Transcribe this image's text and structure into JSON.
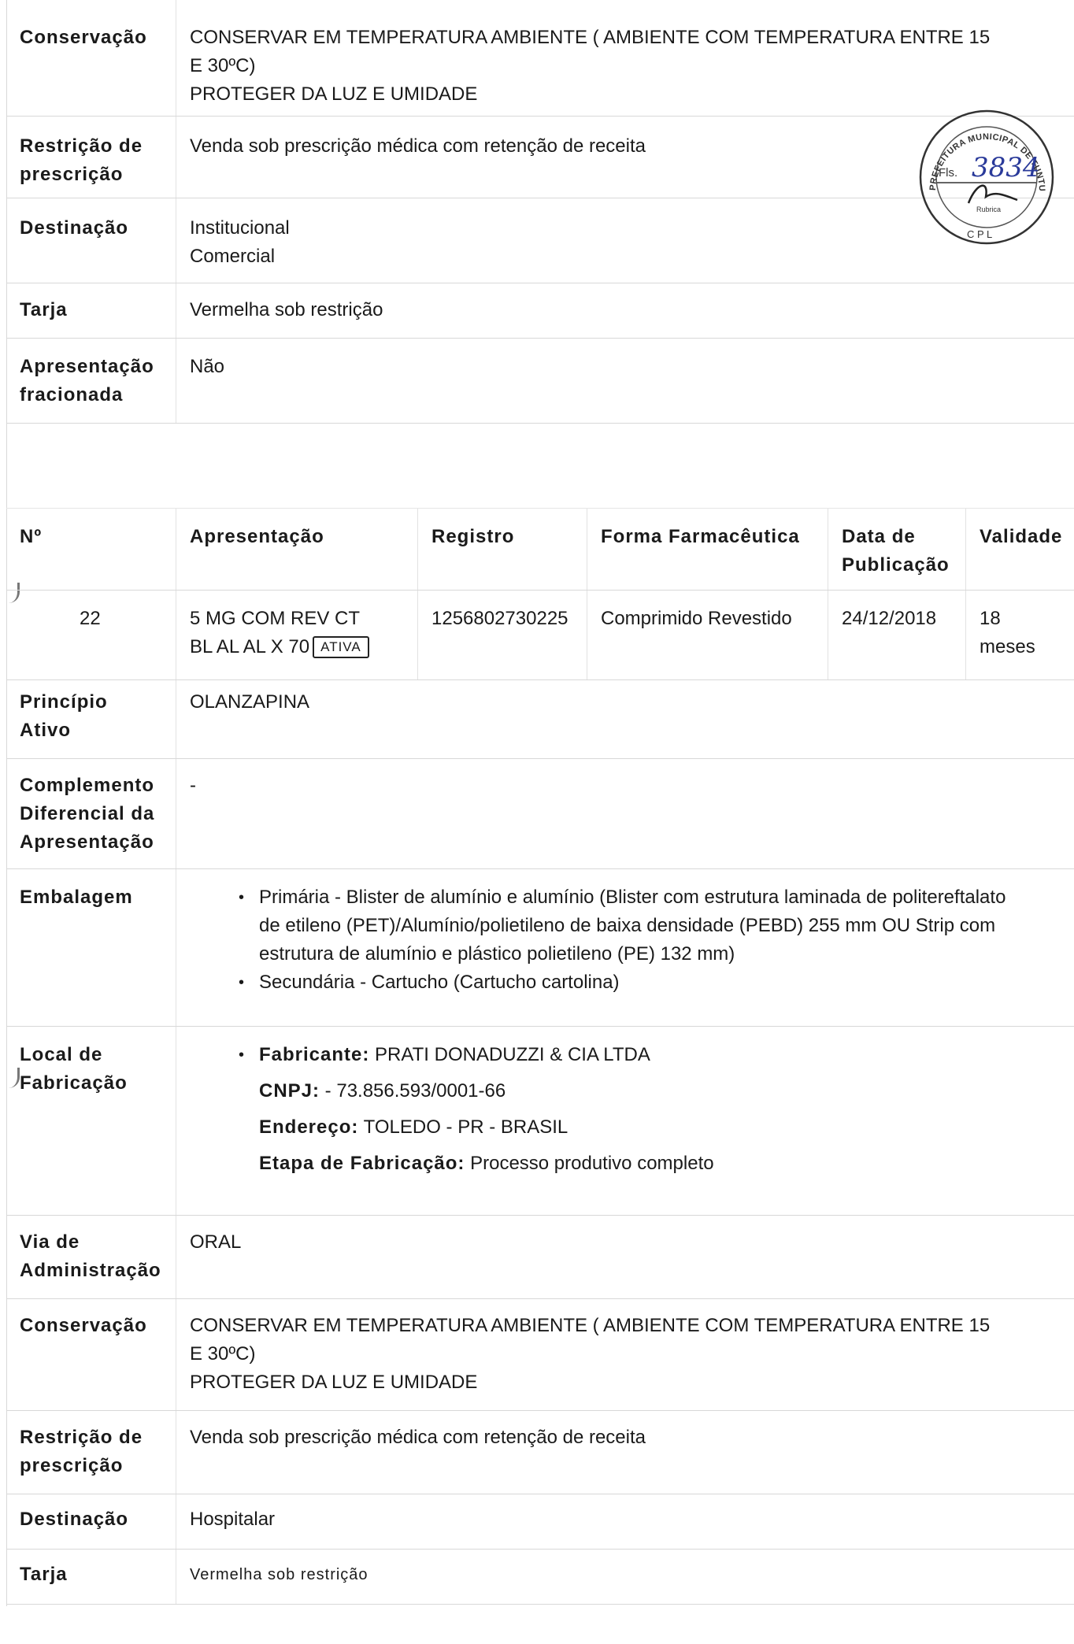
{
  "block1": {
    "conservacao": {
      "label": "Conservação",
      "lines": [
        "CONSERVAR EM TEMPERATURA AMBIENTE ( AMBIENTE COM TEMPERATURA ENTRE 15",
        "E 30ºC)",
        "PROTEGER DA LUZ E UMIDADE"
      ]
    },
    "restricao": {
      "label_line1": "Restrição de",
      "label_line2": "prescrição",
      "value": "Venda sob prescrição médica com retenção de receita"
    },
    "destinacao": {
      "label": "Destinação",
      "lines": [
        "Institucional",
        "Comercial"
      ]
    },
    "tarja": {
      "label": "Tarja",
      "value": "Vermelha sob restrição"
    },
    "fracionada": {
      "label_line1": "Apresentação",
      "label_line2": "fracionada",
      "value": "Não"
    }
  },
  "seal": {
    "ring_text": "PREFEITURA MUNICIPAL DE TUNTUM-MA",
    "fls_label": "Fls.",
    "number": "3834",
    "rubrica": "Rubrica",
    "cpl": "C P L"
  },
  "table_header": {
    "n": "Nº",
    "apresentacao": "Apresentação",
    "registro": "Registro",
    "forma": "Forma Farmacêutica",
    "data_line1": "Data de",
    "data_line2": "Publicação",
    "validade": "Validade"
  },
  "row22": {
    "n": "22",
    "apres_line1": "5 MG COM REV CT",
    "apres_line2": "BL AL AL X 70",
    "badge": "ATIVA",
    "registro": "1256802730225",
    "forma": "Comprimido Revestido",
    "data": "24/12/2018",
    "validade_line1": "18",
    "validade_line2": "meses"
  },
  "block2": {
    "principio": {
      "label_line1": "Princípio",
      "label_line2": "Ativo",
      "value": "OLANZAPINA"
    },
    "complemento": {
      "label_line1": "Complemento",
      "label_line2": "Diferencial da",
      "label_line3": "Apresentação",
      "value": "-"
    },
    "embalagem": {
      "label": "Embalagem",
      "item1_lines": [
        "Primária - Blister de alumínio e alumínio (Blister com estrutura laminada de politereftalato",
        "de etileno (PET)/Alumínio/polietileno de baixa densidade (PEBD) 255 mm OU Strip com",
        "estrutura de alumínio e plástico polietileno (PE) 132 mm)"
      ],
      "item2": "Secundária - Cartucho (Cartucho cartolina)"
    },
    "local": {
      "label_line1": "Local de",
      "label_line2": "Fabricação",
      "fabricante_label": "Fabricante:",
      "fabricante_value": " PRATI DONADUZZI & CIA LTDA",
      "cnpj_label": "CNPJ:",
      "cnpj_value": " - 73.856.593/0001-66",
      "endereco_label": "Endereço:",
      "endereco_value": " TOLEDO - PR - BRASIL",
      "etapa_label": "Etapa de Fabricação:",
      "etapa_value": " Processo produtivo completo"
    },
    "via": {
      "label_line1": "Via de",
      "label_line2": "Administração",
      "value": "ORAL"
    },
    "conservacao": {
      "label": "Conservação",
      "lines": [
        "CONSERVAR EM TEMPERATURA AMBIENTE ( AMBIENTE COM TEMPERATURA ENTRE 15",
        "E 30ºC)",
        "PROTEGER DA LUZ E UMIDADE"
      ]
    },
    "restricao": {
      "label_line1": "Restrição de",
      "label_line2": "prescrição",
      "value": "Venda sob prescrição médica com retenção de receita"
    },
    "destinacao": {
      "label": "Destinação",
      "value": "Hospitalar"
    },
    "tarja": {
      "label": "Tarja",
      "value": "Vermelha sob restrição"
    }
  }
}
